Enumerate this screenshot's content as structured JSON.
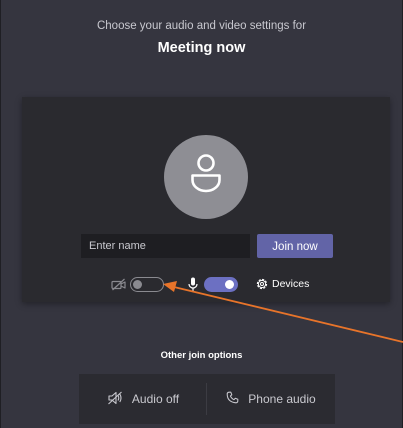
{
  "header": {
    "subtitle": "Choose your audio and video settings for",
    "meeting_title": "Meeting now"
  },
  "preview": {
    "avatar_icon": "person-icon",
    "name_placeholder": "Enter name",
    "join_label": "Join now"
  },
  "controls": {
    "camera_icon": "camera-off-icon",
    "camera_enabled": false,
    "mic_icon": "microphone-icon",
    "mic_enabled": true,
    "devices_icon": "gear-icon",
    "devices_label": "Devices"
  },
  "other_options": {
    "label": "Other join options",
    "audio_off_label": "Audio off",
    "audio_off_icon": "speaker-off-icon",
    "phone_audio_label": "Phone audio",
    "phone_audio_icon": "phone-icon"
  },
  "colors": {
    "background": "#35353f",
    "card": "#2a2a2f",
    "accent": "#6264a7",
    "annotation_arrow": "#e8742a"
  }
}
